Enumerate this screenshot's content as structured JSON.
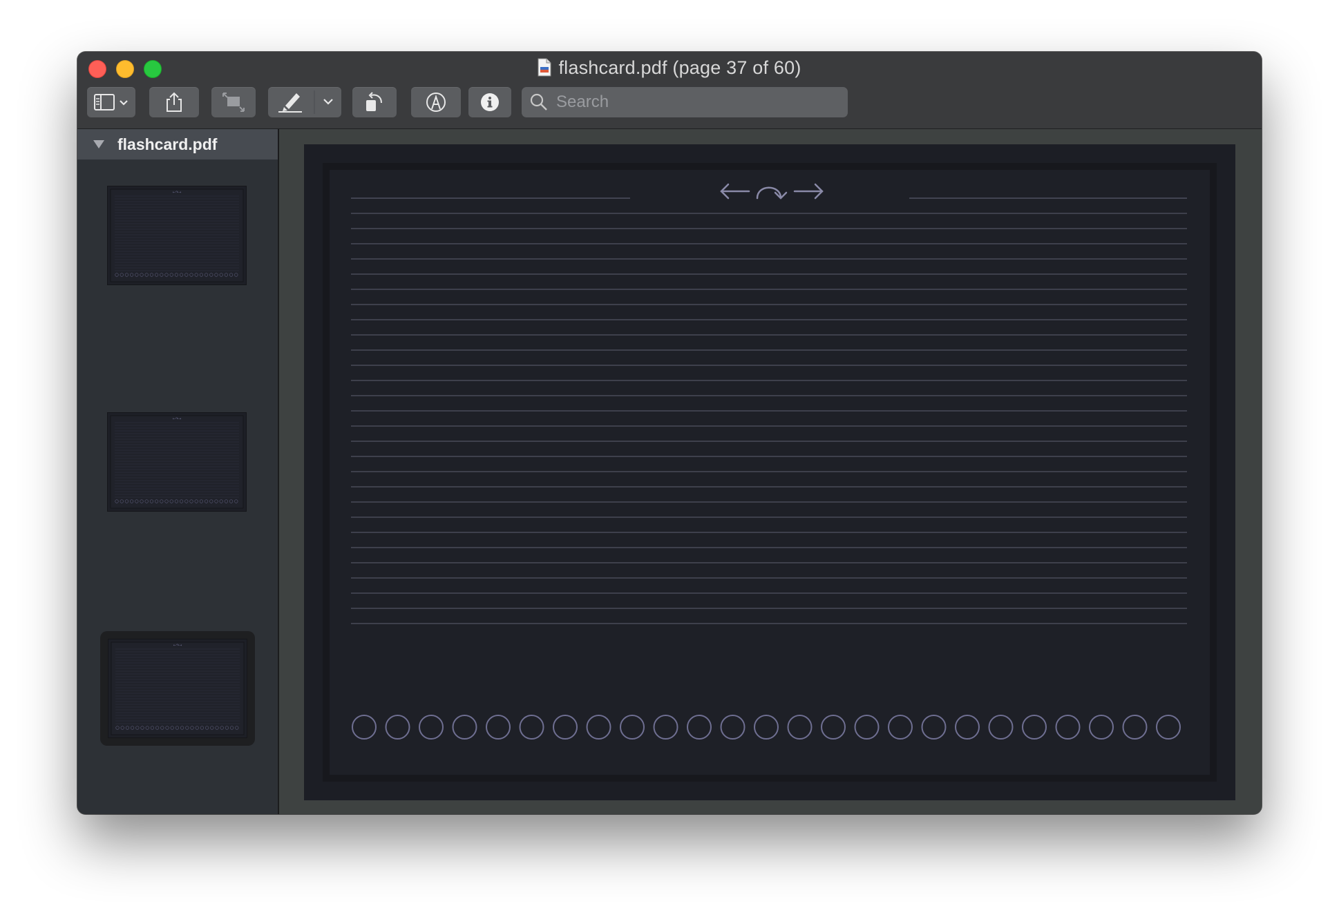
{
  "window": {
    "title": "flashcard.pdf (page 37 of 60)",
    "traffic_lights": [
      "close",
      "minimize",
      "zoom"
    ]
  },
  "toolbar": {
    "buttons": [
      {
        "name": "sidebar-toggle",
        "icon": "sidebar-icon",
        "has_menu": true
      },
      {
        "name": "share",
        "icon": "share-icon"
      },
      {
        "name": "zoom-fit",
        "icon": "resize-icon"
      },
      {
        "name": "highlight",
        "icon": "highlighter-icon",
        "has_menu": true
      },
      {
        "name": "rotate",
        "icon": "rotate-left-icon"
      },
      {
        "name": "markup",
        "icon": "markup-pen-icon"
      },
      {
        "name": "inspector",
        "icon": "info-icon"
      }
    ],
    "search": {
      "placeholder": "Search",
      "value": ""
    }
  },
  "sidebar": {
    "document_name": "flashcard.pdf",
    "thumbnails": [
      {
        "label": "page",
        "selected": false
      },
      {
        "label": "page",
        "selected": false
      },
      {
        "label": "page",
        "selected": true
      }
    ]
  },
  "page": {
    "header_symbols": "←↷→",
    "ruled_lines": 28,
    "bubble_count": 25
  },
  "colors": {
    "window_bg": "#3c3f41",
    "page_bg": "#1c1e25",
    "rule_line": "#4a4c5a",
    "bubble_stroke": "#6f6f92"
  }
}
